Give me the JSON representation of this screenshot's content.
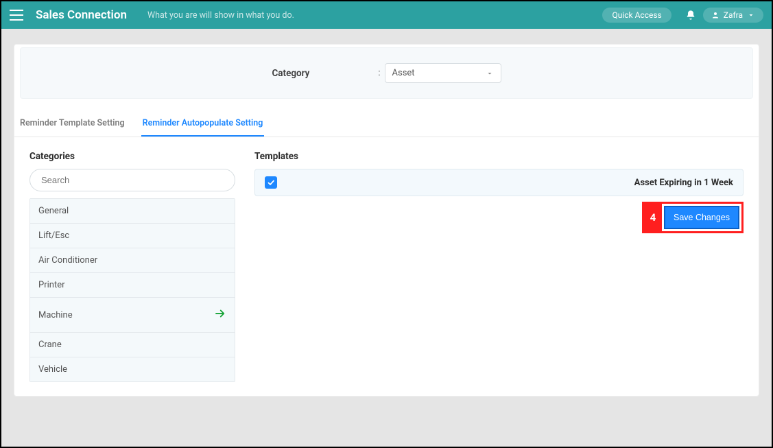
{
  "header": {
    "brand": "Sales Connection",
    "tagline": "What you are will show in what you do.",
    "quick_access": "Quick Access",
    "user_name": "Zafra"
  },
  "filter": {
    "label": "Category",
    "separator": ":",
    "selected": "Asset"
  },
  "tabs": [
    {
      "label": "Reminder Template Setting",
      "active": false
    },
    {
      "label": "Reminder Autopopulate Setting",
      "active": true
    }
  ],
  "categories": {
    "title": "Categories",
    "search_placeholder": "Search",
    "items": [
      {
        "label": "General",
        "selected": false
      },
      {
        "label": "Lift/Esc",
        "selected": false
      },
      {
        "label": "Air Conditioner",
        "selected": false
      },
      {
        "label": "Printer",
        "selected": false
      },
      {
        "label": "Machine",
        "selected": true
      },
      {
        "label": "Crane",
        "selected": false
      },
      {
        "label": "Vehicle",
        "selected": false
      }
    ]
  },
  "templates": {
    "title": "Templates",
    "items": [
      {
        "label": "Asset Expiring in 1 Week",
        "checked": true
      }
    ]
  },
  "callout": {
    "number": "4"
  },
  "actions": {
    "save": "Save Changes"
  },
  "colors": {
    "brand_teal": "#2ca1a1",
    "accent_blue": "#1e88ff",
    "callout_red": "#ff1f1f",
    "selected_arrow_green": "#15a336"
  }
}
